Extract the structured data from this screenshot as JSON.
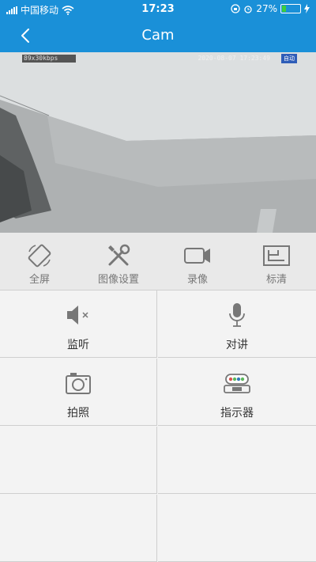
{
  "status_bar": {
    "carrier": "中国移动",
    "time": "17:23",
    "battery_percent": "27%",
    "battery_level": 0.27
  },
  "nav": {
    "title": "Cam"
  },
  "video": {
    "overlay_left": "89x30kbps",
    "overlay_time": "2020-08-07 17:23:49",
    "overlay_badge": "自动"
  },
  "toolbar": {
    "items": [
      {
        "label": "全屏",
        "icon": "fullscreen-rotate-icon"
      },
      {
        "label": "图像设置",
        "icon": "wrench-screwdriver-icon"
      },
      {
        "label": "录像",
        "icon": "video-camera-icon"
      },
      {
        "label": "标清",
        "icon": "quality-frame-icon"
      }
    ]
  },
  "grid": {
    "items": [
      {
        "label": "监听",
        "icon": "speaker-muted-icon"
      },
      {
        "label": "对讲",
        "icon": "microphone-icon"
      },
      {
        "label": "拍照",
        "icon": "camera-icon"
      },
      {
        "label": "指示器",
        "icon": "indicator-light-icon"
      }
    ]
  },
  "colors": {
    "brand_blue": "#1a90d8",
    "toolbar_gray": "#e9e9e9",
    "icon_gray": "#777777"
  }
}
